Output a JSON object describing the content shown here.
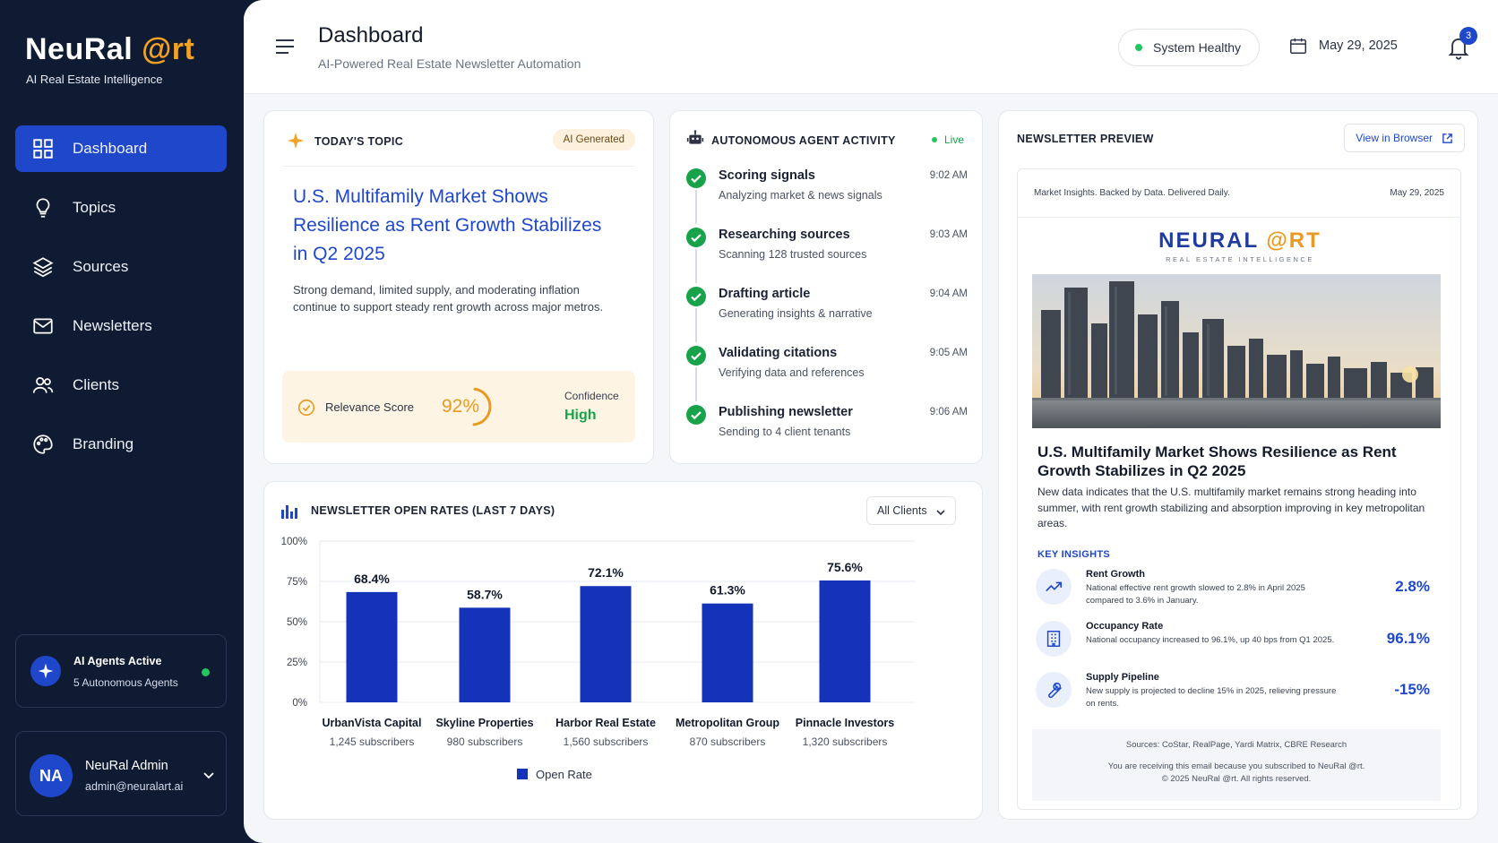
{
  "brand": {
    "name_main": "NeuRal ",
    "name_accent": "@rt",
    "tagline": "AI Real Estate Intelligence"
  },
  "sidebar": {
    "items": [
      {
        "label": "Dashboard",
        "icon": "grid-icon",
        "active": true
      },
      {
        "label": "Topics",
        "icon": "lightbulb-icon"
      },
      {
        "label": "Sources",
        "icon": "layers-icon"
      },
      {
        "label": "Newsletters",
        "icon": "mail-icon"
      },
      {
        "label": "Clients",
        "icon": "users-icon"
      },
      {
        "label": "Branding",
        "icon": "palette-icon"
      }
    ],
    "agents": {
      "title": "AI Agents Active",
      "subtitle": "5 Autonomous Agents"
    },
    "user": {
      "initials": "NA",
      "name": "NeuRal Admin",
      "email": "admin@neuralart.ai"
    }
  },
  "header": {
    "title": "Dashboard",
    "subtitle": "AI-Powered Real Estate Newsletter Automation",
    "status": "System Healthy",
    "date": "May 29, 2025",
    "notifications": "3"
  },
  "topic": {
    "heading": "TODAY'S TOPIC",
    "badge": "AI Generated",
    "title": "U.S. Multifamily Market Shows Resilience as Rent Growth Stabilizes in Q2 2025",
    "description": "Strong demand, limited supply, and moderating inflation continue to support steady rent growth across major metros.",
    "relevance_label": "Relevance Score",
    "relevance_value": "92%",
    "relevance_fraction": 0.92,
    "confidence_label": "Confidence",
    "confidence_value": "High"
  },
  "agent_activity": {
    "heading": "AUTONOMOUS AGENT ACTIVITY",
    "status": "Live",
    "steps": [
      {
        "title": "Scoring signals",
        "subtitle": "Analyzing market & news signals",
        "time": "9:02 AM"
      },
      {
        "title": "Researching sources",
        "subtitle": "Scanning 128 trusted sources",
        "time": "9:03 AM"
      },
      {
        "title": "Drafting article",
        "subtitle": "Generating insights & narrative",
        "time": "9:04 AM"
      },
      {
        "title": "Validating citations",
        "subtitle": "Verifying data and references",
        "time": "9:05 AM"
      },
      {
        "title": "Publishing newsletter",
        "subtitle": "Sending to 4 client tenants",
        "time": "9:06 AM"
      }
    ]
  },
  "preview": {
    "heading": "NEWSLETTER PREVIEW",
    "view_button": "View in Browser",
    "tagline": "Market Insights. Backed by Data. Delivered Daily.",
    "date": "May 29, 2025",
    "logo_main": "NEURAL ",
    "logo_accent": "@RT",
    "logo_sub": "REAL ESTATE INTELLIGENCE",
    "title": "U.S. Multifamily Market Shows Resilience as Rent Growth Stabilizes in Q2 2025",
    "body": "New data indicates that the U.S. multifamily market remains strong heading into summer, with rent growth stabilizing and absorption improving in key metropolitan areas.",
    "key_insights_label": "KEY INSIGHTS",
    "insights": [
      {
        "icon": "trend-up-icon",
        "title": "Rent Growth",
        "desc": "National effective rent growth slowed to 2.8% in April 2025 compared to 3.6% in January.",
        "value": "2.8%"
      },
      {
        "icon": "building-icon",
        "title": "Occupancy Rate",
        "desc": "National occupancy increased to 96.1%, up 40 bps from Q1 2025.",
        "value": "96.1%"
      },
      {
        "icon": "wrench-icon",
        "title": "Supply Pipeline",
        "desc": "New supply is projected to decline 15% in 2025, relieving pressure on rents.",
        "value": "-15%"
      }
    ],
    "sources": "Sources: CoStar, RealPage, Yardi Matrix, CBRE Research",
    "footer1": "You are receiving this email because you subscribed to NeuRal @rt.",
    "footer2": "© 2025 NeuRal @rt. All rights reserved."
  },
  "chart_card": {
    "heading": "NEWSLETTER OPEN RATES (LAST 7 DAYS)",
    "filter": "All Clients"
  },
  "chart_data": {
    "type": "bar",
    "categories": [
      "UrbanVista Capital",
      "Skyline Properties",
      "Harbor Real Estate",
      "Metropolitan Group",
      "Pinnacle Investors"
    ],
    "subcategories": [
      "1,245 subscribers",
      "980 subscribers",
      "1,560 subscribers",
      "870 subscribers",
      "1,320 subscribers"
    ],
    "series": [
      {
        "name": "Open Rate",
        "values": [
          68.4,
          58.7,
          72.1,
          61.3,
          75.6
        ]
      }
    ],
    "data_labels": [
      "68.4%",
      "58.7%",
      "72.1%",
      "61.3%",
      "75.6%"
    ],
    "yticks": [
      "0%",
      "25%",
      "50%",
      "75%",
      "100%"
    ],
    "ylim": [
      0,
      100
    ],
    "grid": true,
    "legend": "bottom",
    "color": "#1433b8"
  }
}
